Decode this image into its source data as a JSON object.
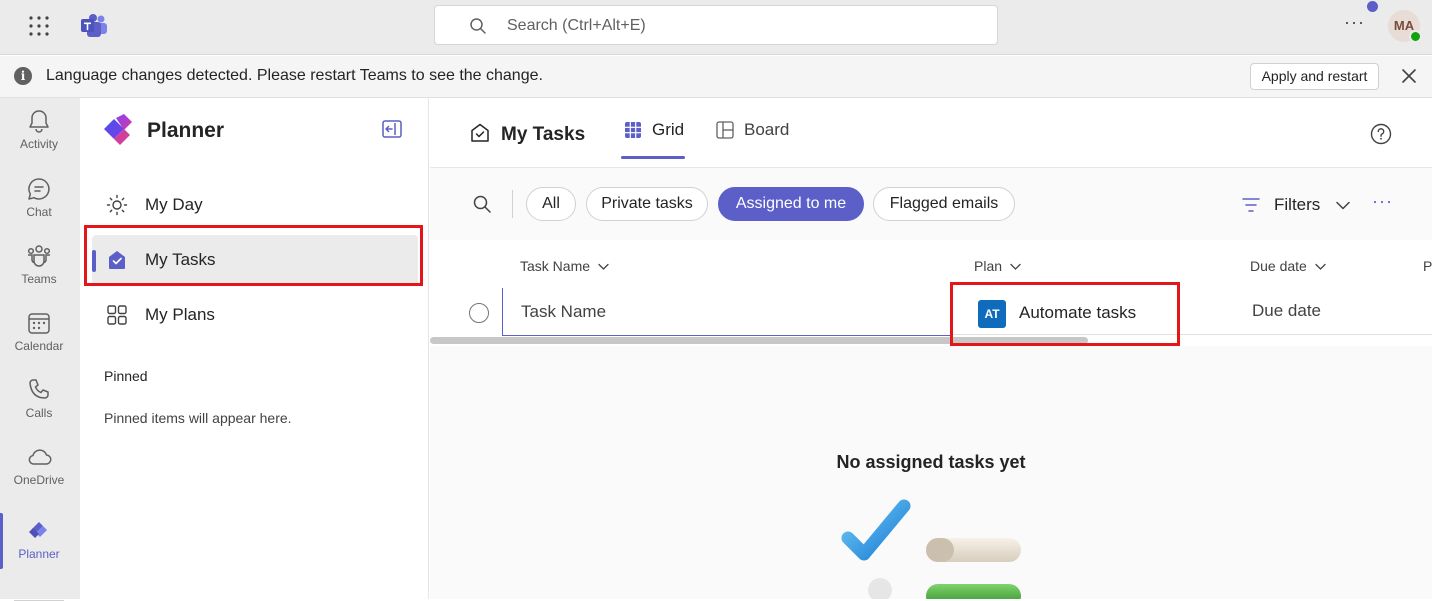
{
  "topbar": {
    "search_placeholder": "Search (Ctrl+Alt+E)",
    "more_label": "···",
    "avatar_initials": "MA"
  },
  "banner": {
    "message": "Language changes detected. Please restart Teams to see the change.",
    "apply_button": "Apply and restart",
    "info_glyph": "i"
  },
  "rail": {
    "items": [
      {
        "label": "Activity",
        "icon": "bell-icon"
      },
      {
        "label": "Chat",
        "icon": "chat-icon"
      },
      {
        "label": "Teams",
        "icon": "teams-icon"
      },
      {
        "label": "Calendar",
        "icon": "calendar-icon"
      },
      {
        "label": "Calls",
        "icon": "phone-icon"
      },
      {
        "label": "OneDrive",
        "icon": "cloud-icon"
      },
      {
        "label": "Planner",
        "icon": "planner-icon",
        "active": true
      }
    ]
  },
  "nav": {
    "app_title": "Planner",
    "items": [
      {
        "label": "My Day",
        "icon": "sun-icon"
      },
      {
        "label": "My Tasks",
        "icon": "my-tasks-icon",
        "selected": true
      },
      {
        "label": "My Plans",
        "icon": "grid-apps-icon"
      }
    ],
    "pinned_heading": "Pinned",
    "pinned_empty": "Pinned items will appear here."
  },
  "main": {
    "title": "My Tasks",
    "tabs": [
      {
        "label": "Grid",
        "active": true
      },
      {
        "label": "Board",
        "active": false
      }
    ],
    "filters": {
      "pills": [
        "All",
        "Private tasks",
        "Assigned to me",
        "Flagged emails"
      ],
      "active_pill": "Assigned to me",
      "filters_label": "Filters",
      "more_label": "···"
    },
    "grid": {
      "columns": [
        "Task Name",
        "Plan",
        "Due date",
        "P"
      ],
      "new_row": {
        "task_placeholder": "Task Name",
        "plan_badge": "AT",
        "plan_name": "Automate tasks",
        "due_placeholder": "Due date"
      }
    },
    "empty_state": "No assigned tasks yet"
  },
  "colors": {
    "accent": "#5b5fc7",
    "highlight": "#e3161c",
    "plan_badge": "#0f6cbd"
  }
}
